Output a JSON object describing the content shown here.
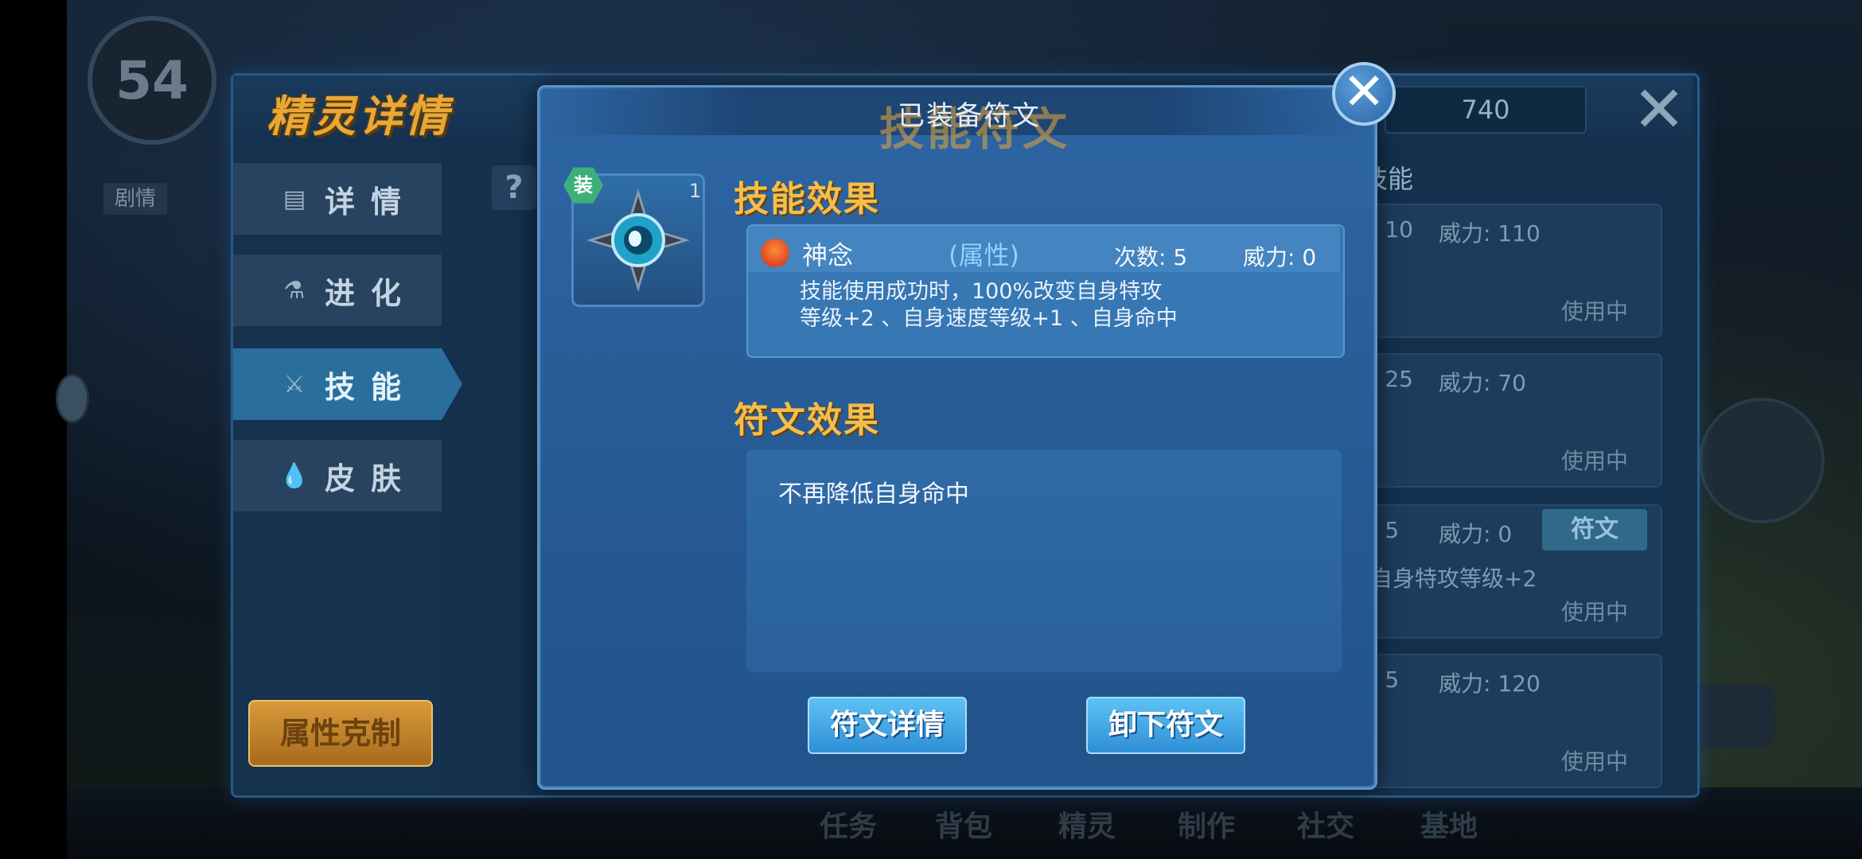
{
  "background": {
    "level": "54",
    "story_tag": "剧情",
    "bottom_nav": [
      "任务",
      "背包",
      "精灵",
      "制作",
      "社交",
      "基地"
    ]
  },
  "main_panel": {
    "title": "精灵详情",
    "tabs": [
      {
        "label": "详情",
        "icon": "document-icon"
      },
      {
        "label": "进化",
        "icon": "flask-icon"
      },
      {
        "label": "技能",
        "icon": "sword-icon",
        "active": true
      },
      {
        "label": "皮肤",
        "icon": "drop-icon"
      }
    ],
    "help_label": "?",
    "type_chart_label": "属性克制",
    "score": "740",
    "close_label": "✕",
    "skills_heading": "技能",
    "skills": [
      {
        "count": ": 10",
        "power": "威力: 110",
        "status": "使用中"
      },
      {
        "count": ": 25",
        "power": "威力: 70",
        "status": "使用中"
      },
      {
        "count": ": 5",
        "power": "威力: 0",
        "status": "使用中",
        "rune_tag": "符文",
        "desc": "自身特攻等级+2"
      },
      {
        "count": ": 5",
        "power": "威力: 120",
        "status": "使用中"
      }
    ]
  },
  "modal": {
    "title": "已装备符文",
    "ghost_title": "技能符文",
    "close_label": "✕",
    "rune": {
      "badge": "装",
      "count": "1"
    },
    "skill_effect_title": "技能效果",
    "skill": {
      "name": "神念",
      "attr": "(属性)",
      "count": "次数: 5",
      "power": "威力: 0",
      "desc_line1": "技能使用成功时，100%改变自身特攻",
      "desc_line2": "等级+2 、自身速度等级+1 、自身命中"
    },
    "rune_effect_title": "符文效果",
    "rune_effect_text": "不再降低自身命中",
    "buttons": {
      "detail": "符文详情",
      "unequip": "卸下符文"
    }
  },
  "colors": {
    "accent_gold": "#f4be4a",
    "modal_blue": "#2d66a4",
    "button_blue": "#3a9be0"
  }
}
